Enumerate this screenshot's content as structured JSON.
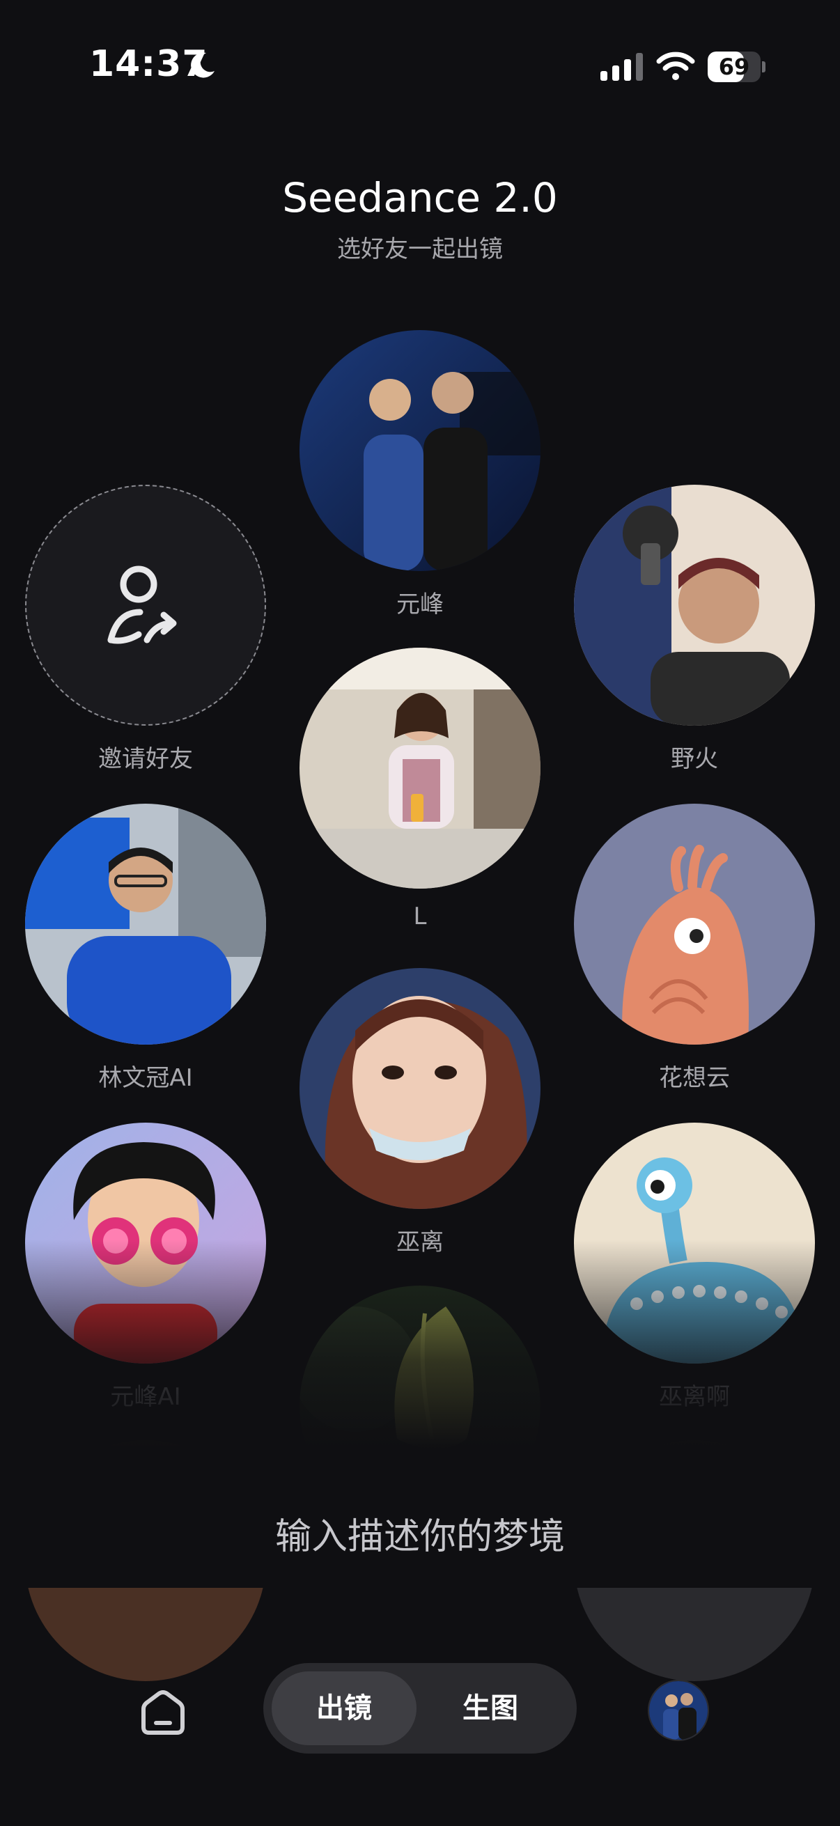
{
  "status_bar": {
    "time": "14:37",
    "battery_level": "69",
    "battery_fraction": 0.69,
    "icons": [
      "moon-icon",
      "signal-icon",
      "wifi-icon",
      "battery-icon"
    ]
  },
  "header": {
    "title": "Seedance 2.0",
    "subtitle": "选好友一起出镜"
  },
  "friends": [
    {
      "name": "元峰",
      "avatar": "photo-two-men-on-stage"
    },
    {
      "name": "邀请好友",
      "avatar": "invite-person-icon"
    },
    {
      "name": "野火",
      "avatar": "photo-man-selfie"
    },
    {
      "name": "L",
      "avatar": "photo-woman-sitting"
    },
    {
      "name": "林文冠AI",
      "avatar": "photo-man-blue-shirt"
    },
    {
      "name": "花想云",
      "avatar": "cartoon-orange-creature"
    },
    {
      "name": "巫离",
      "avatar": "photo-woman-face"
    },
    {
      "name": "元峰AI",
      "avatar": "cartoon-boy-pink-glasses"
    },
    {
      "name": "巫离啊",
      "avatar": "cartoon-blue-creature"
    },
    {
      "name": "",
      "avatar": "photo-flower-bud"
    }
  ],
  "prompt": {
    "placeholder": "输入描述你的梦境"
  },
  "bottom_nav": {
    "home_icon": "home-icon",
    "modes": [
      "出镜",
      "生图"
    ],
    "active_mode": "出镜"
  },
  "colors": {
    "background": "#0f0f12",
    "muted_text": "#a9a9ae",
    "switch_bg": "#2a2a2e",
    "switch_active": "#3e3e43"
  }
}
